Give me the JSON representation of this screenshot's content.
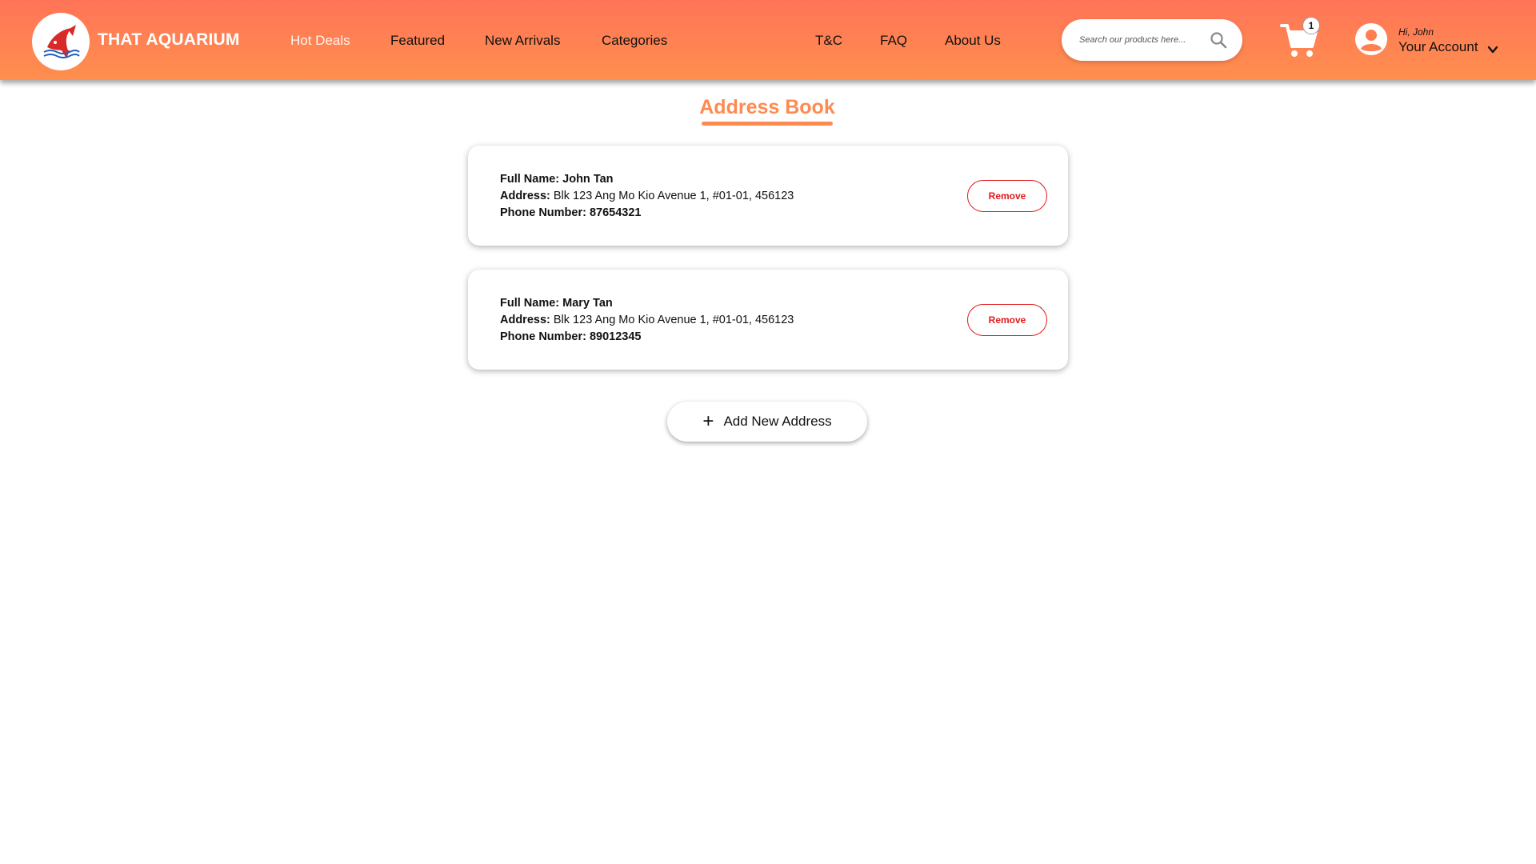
{
  "header": {
    "brand": "THAT AQUARIUM",
    "nav_left": [
      {
        "label": "Hot Deals",
        "active": true
      },
      {
        "label": "Featured",
        "active": false
      },
      {
        "label": "New Arrivals",
        "active": false
      },
      {
        "label": "Categories",
        "active": false
      }
    ],
    "nav_right": [
      {
        "label": "T&C"
      },
      {
        "label": "FAQ"
      },
      {
        "label": "About Us"
      }
    ],
    "search": {
      "placeholder": "Search our products here...",
      "icon": "search-icon"
    },
    "cart": {
      "count": "1",
      "icon": "shopping-cart-icon"
    },
    "account": {
      "greeting": "Hi, John",
      "label": "Your Account",
      "icon": "user-avatar-icon"
    }
  },
  "colors": {
    "header_gradient_start": "#ff7458",
    "header_gradient_end": "#ff8f4e",
    "accent": "#ff8a50",
    "remove": "#e01b1b"
  },
  "main": {
    "title": "Address Book",
    "addresses": [
      {
        "name_label": "Full Name:",
        "name": "John Tan",
        "address_label": "Address:",
        "address": "Blk 123 Ang Mo Kio Avenue 1, #01-01, 456123",
        "phone_label": "Phone Number:",
        "phone": "87654321",
        "remove_label": "Remove"
      },
      {
        "name_label": "Full Name:",
        "name": "Mary Tan",
        "address_label": "Address:",
        "address": "Blk 123 Ang Mo Kio Avenue 1, #01-01, 456123",
        "phone_label": "Phone Number:",
        "phone": "89012345",
        "remove_label": "Remove"
      }
    ],
    "add_button": {
      "label": "Add New Address",
      "icon": "plus-icon"
    }
  }
}
